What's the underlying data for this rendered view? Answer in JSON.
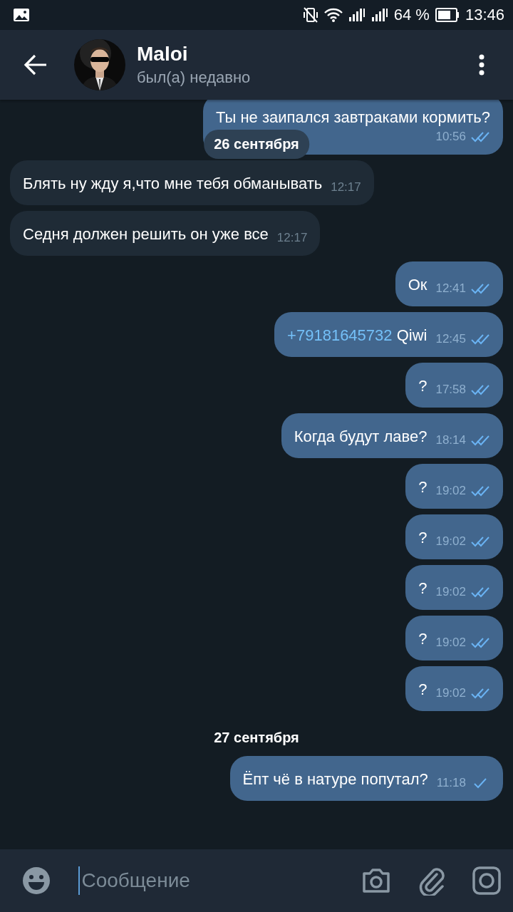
{
  "status_bar": {
    "battery": "64 %",
    "time": "13:46"
  },
  "header": {
    "name": "Maloi",
    "status": "был(а) недавно"
  },
  "floating_date": "26 сентября",
  "messages": [
    {
      "kind": "message",
      "outgoing": true,
      "text": "Ты не заипался завтраками кормить?",
      "time": "10:56",
      "read": true
    },
    {
      "kind": "message",
      "outgoing": false,
      "text": "Блять ну жду я,что мне тебя обманывать",
      "time": "12:17"
    },
    {
      "kind": "message",
      "outgoing": false,
      "text": "Седня должен решить он уже все",
      "time": "12:17"
    },
    {
      "kind": "message",
      "outgoing": true,
      "text": "Ок",
      "time": "12:41",
      "read": true
    },
    {
      "kind": "message",
      "outgoing": true,
      "link": "+79181645732",
      "text": "Qiwi",
      "time": "12:45",
      "read": true
    },
    {
      "kind": "message",
      "outgoing": true,
      "text": "?",
      "time": "17:58",
      "read": true
    },
    {
      "kind": "message",
      "outgoing": true,
      "text": "Когда будут лаве?",
      "time": "18:14",
      "read": true
    },
    {
      "kind": "message",
      "outgoing": true,
      "text": "?",
      "time": "19:02",
      "read": true
    },
    {
      "kind": "message",
      "outgoing": true,
      "text": "?",
      "time": "19:02",
      "read": true
    },
    {
      "kind": "message",
      "outgoing": true,
      "text": "?",
      "time": "19:02",
      "read": true
    },
    {
      "kind": "message",
      "outgoing": true,
      "text": "?",
      "time": "19:02",
      "read": true
    },
    {
      "kind": "message",
      "outgoing": true,
      "text": "?",
      "time": "19:02",
      "read": true
    },
    {
      "kind": "date",
      "text": "27 сентября"
    },
    {
      "kind": "message",
      "outgoing": true,
      "text": "Ёпт чё в натуре попутал?",
      "time": "11:18",
      "read": false
    }
  ],
  "composer": {
    "placeholder": "Сообщение"
  }
}
